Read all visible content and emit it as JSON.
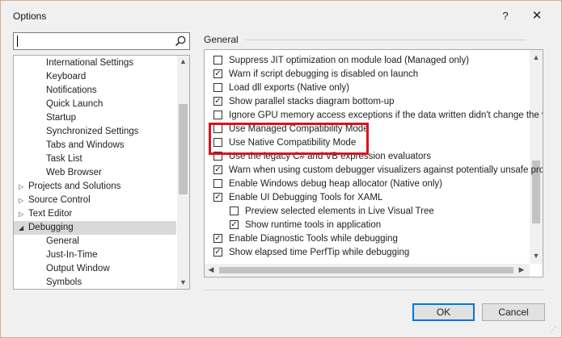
{
  "window": {
    "title": "Options",
    "help_label": "?",
    "close_label": "✕"
  },
  "search": {
    "value": "",
    "placeholder": ""
  },
  "tree": {
    "items": [
      {
        "label": "International Settings",
        "level": 2,
        "expander": ""
      },
      {
        "label": "Keyboard",
        "level": 2,
        "expander": ""
      },
      {
        "label": "Notifications",
        "level": 2,
        "expander": ""
      },
      {
        "label": "Quick Launch",
        "level": 2,
        "expander": ""
      },
      {
        "label": "Startup",
        "level": 2,
        "expander": ""
      },
      {
        "label": "Synchronized Settings",
        "level": 2,
        "expander": ""
      },
      {
        "label": "Tabs and Windows",
        "level": 2,
        "expander": ""
      },
      {
        "label": "Task List",
        "level": 2,
        "expander": ""
      },
      {
        "label": "Web Browser",
        "level": 2,
        "expander": ""
      },
      {
        "label": "Projects and Solutions",
        "level": 1,
        "expander": "▷"
      },
      {
        "label": "Source Control",
        "level": 1,
        "expander": "▷"
      },
      {
        "label": "Text Editor",
        "level": 1,
        "expander": "▷"
      },
      {
        "label": "Debugging",
        "level": 1,
        "expander": "◢",
        "selected": true
      },
      {
        "label": "General",
        "level": 2,
        "expander": ""
      },
      {
        "label": "Just-In-Time",
        "level": 2,
        "expander": ""
      },
      {
        "label": "Output Window",
        "level": 2,
        "expander": ""
      },
      {
        "label": "Symbols",
        "level": 2,
        "expander": ""
      }
    ]
  },
  "section": {
    "title": "General"
  },
  "options": [
    {
      "label": "Suppress JIT optimization on module load (Managed only)",
      "checked": false,
      "indent": 0
    },
    {
      "label": "Warn if script debugging is disabled on launch",
      "checked": true,
      "indent": 0
    },
    {
      "label": "Load dll exports (Native only)",
      "checked": false,
      "indent": 0
    },
    {
      "label": "Show parallel stacks diagram bottom-up",
      "checked": true,
      "indent": 0
    },
    {
      "label": "Ignore GPU memory access exceptions if the data written didn't change the v",
      "checked": false,
      "indent": 0
    },
    {
      "label": "Use Managed Compatibility Mode",
      "checked": false,
      "indent": 0
    },
    {
      "label": "Use Native Compatibility Mode",
      "checked": false,
      "indent": 0
    },
    {
      "label": "Use the legacy C# and VB expression evaluators",
      "checked": false,
      "indent": 0
    },
    {
      "label": "Warn when using custom debugger visualizers against potentially unsafe pro",
      "checked": true,
      "indent": 0
    },
    {
      "label": "Enable Windows debug heap allocator (Native only)",
      "checked": false,
      "indent": 0
    },
    {
      "label": "Enable UI Debugging Tools for XAML",
      "checked": true,
      "indent": 0
    },
    {
      "label": "Preview selected elements in Live Visual Tree",
      "checked": false,
      "indent": 1
    },
    {
      "label": "Show runtime tools in application",
      "checked": true,
      "indent": 1
    },
    {
      "label": "Enable Diagnostic Tools while debugging",
      "checked": true,
      "indent": 0
    },
    {
      "label": "Show elapsed time PerfTip while debugging",
      "checked": true,
      "indent": 0
    }
  ],
  "buttons": {
    "ok": "OK",
    "cancel": "Cancel"
  },
  "colors": {
    "highlight": "#d9131c",
    "default_button_border": "#0078d7",
    "selected_row": "#d9d9d9"
  }
}
